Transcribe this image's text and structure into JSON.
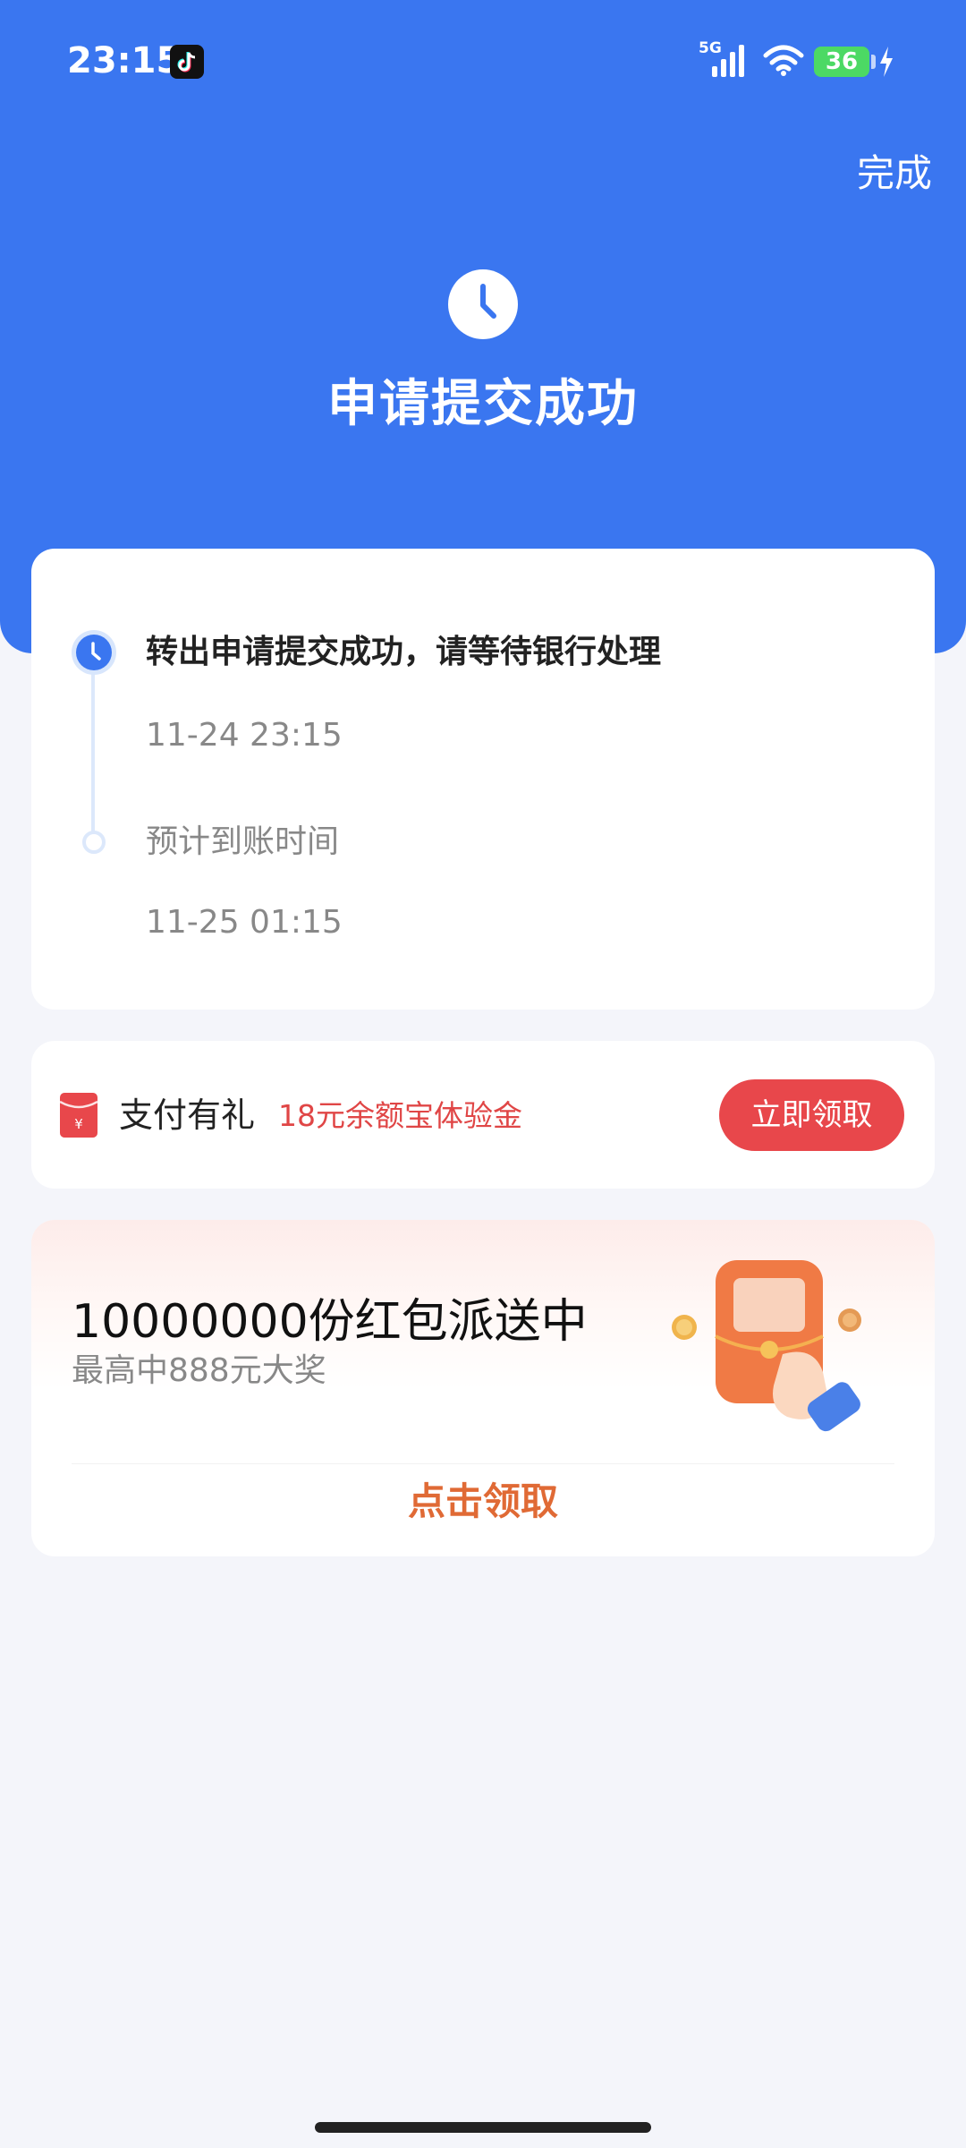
{
  "status_bar": {
    "time": "23:15",
    "network": "5G",
    "battery": "36"
  },
  "header": {
    "done_label": "完成",
    "title": "申请提交成功"
  },
  "timeline": {
    "steps": [
      {
        "label": "转出申请提交成功，请等待银行处理",
        "time": "11-24 23:15"
      },
      {
        "label": "预计到账时间",
        "time": "11-25 01:15"
      }
    ]
  },
  "gift": {
    "title": "支付有礼",
    "desc": "18元余额宝体验金",
    "button_label": "立即领取"
  },
  "promo": {
    "title": "10000000份红包派送中",
    "subtitle": "最高中888元大奖",
    "cta_label": "点击领取"
  },
  "colors": {
    "brand_blue": "#3a76f0",
    "red": "#e8474b",
    "orange": "#e06a35"
  }
}
